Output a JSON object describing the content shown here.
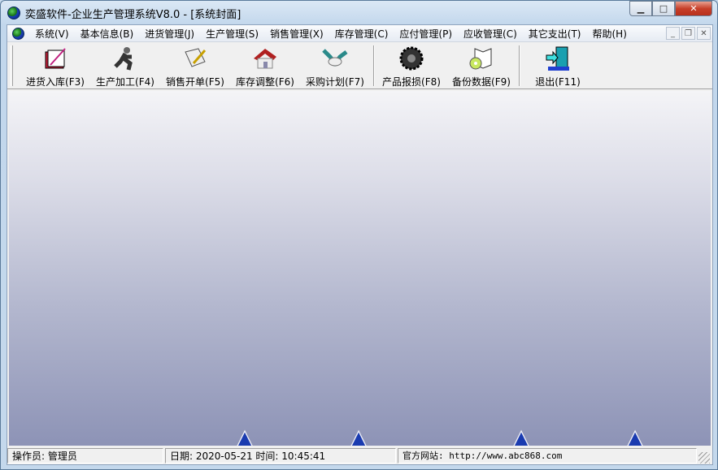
{
  "window": {
    "title": "奕盛软件-企业生产管理系统V8.0 - [系统封面]"
  },
  "menu": [
    "系统(V)",
    "基本信息(B)",
    "进货管理(J)",
    "生产管理(S)",
    "销售管理(X)",
    "库存管理(C)",
    "应付管理(P)",
    "应收管理(C)",
    "其它支出(T)",
    "帮助(H)"
  ],
  "toolbar": [
    {
      "label": "进货入库(F3)",
      "icon": "purchase-book-icon"
    },
    {
      "label": "生产加工(F4)",
      "icon": "running-man-icon"
    },
    {
      "label": "销售开单(F5)",
      "icon": "scroll-pen-icon"
    },
    {
      "label": "库存调整(F6)",
      "icon": "house-icon"
    },
    {
      "label": "采购计划(F7)",
      "icon": "handshake-icon"
    },
    {
      "label": "产品报损(F8)",
      "icon": "gear-icon"
    },
    {
      "label": "备份数据(F9)",
      "icon": "book-disc-icon"
    },
    {
      "label": "退出(F11)",
      "icon": "exit-door-icon"
    }
  ],
  "status": {
    "operator": "操作员: 管理员",
    "datetime": "日期: 2020-05-21  时间: 10:45:41",
    "website": "官方网站: http://www.abc868.com"
  }
}
